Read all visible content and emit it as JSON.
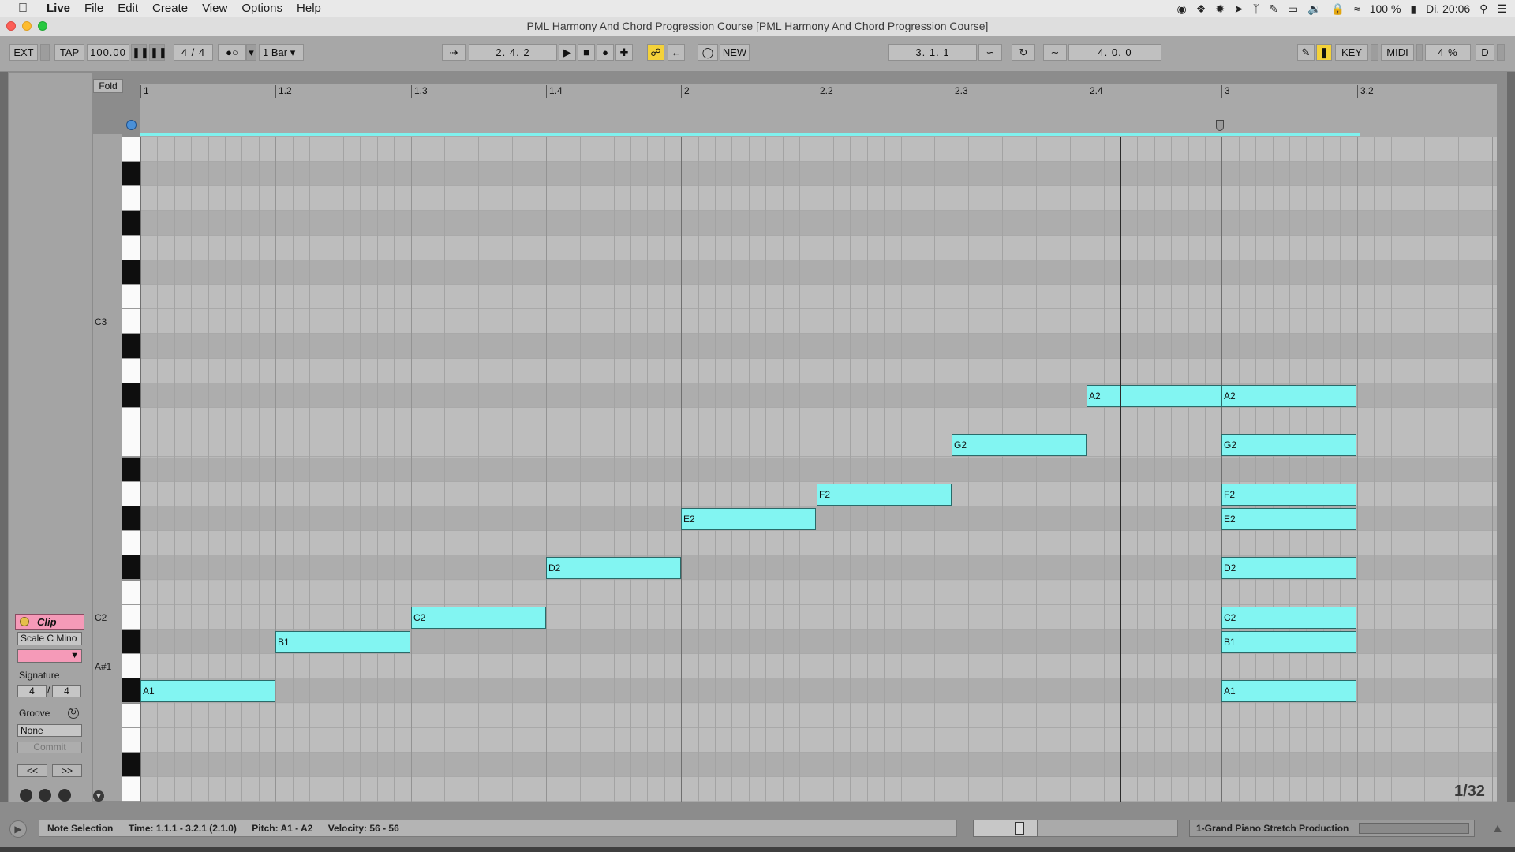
{
  "menubar": {
    "items": [
      "Live",
      "File",
      "Edit",
      "Create",
      "View",
      "Options",
      "Help"
    ],
    "battery": "100 %",
    "clock": "Di. 20:06"
  },
  "window": {
    "title": "PML Harmony And Chord Progression Course  [PML Harmony And Chord Progression Course]"
  },
  "control": {
    "ext": "EXT",
    "tap": "TAP",
    "tempo": "100.00",
    "signature": "4 / 4",
    "quantize": "1 Bar",
    "position": "2.   4.   2",
    "new": "NEW",
    "loop_start": "3.   1.   1",
    "loop_length": "4.   0.   0",
    "key": "KEY",
    "midi": "MIDI",
    "cpu": "4 %",
    "d": "D"
  },
  "editor": {
    "fold": "Fold",
    "ruler": [
      "1",
      "1.2",
      "1.3",
      "1.4",
      "2",
      "2.2",
      "2.3",
      "2.4",
      "3",
      "3.2"
    ],
    "key_labels": [
      "C3",
      "C2",
      "A#1"
    ],
    "zoom": "1/32",
    "accent": "#82f5f2",
    "notes": [
      {
        "label": "A1",
        "row": 22,
        "start": 0,
        "len": 1
      },
      {
        "label": "B1",
        "row": 20,
        "start": 1,
        "len": 1
      },
      {
        "label": "C2",
        "row": 19,
        "start": 2,
        "len": 1
      },
      {
        "label": "D2",
        "row": 17,
        "start": 3,
        "len": 1
      },
      {
        "label": "E2",
        "row": 15,
        "start": 4,
        "len": 1
      },
      {
        "label": "F2",
        "row": 14,
        "start": 5,
        "len": 1
      },
      {
        "label": "G2",
        "row": 12,
        "start": 6,
        "len": 1
      },
      {
        "label": "A2",
        "row": 10,
        "start": 7,
        "len": 1
      },
      {
        "label": "A2",
        "row": 10,
        "start": 8,
        "len": 1
      },
      {
        "label": "G2",
        "row": 12,
        "start": 8,
        "len": 1
      },
      {
        "label": "F2",
        "row": 14,
        "start": 8,
        "len": 1
      },
      {
        "label": "E2",
        "row": 15,
        "start": 8,
        "len": 1
      },
      {
        "label": "D2",
        "row": 17,
        "start": 8,
        "len": 1
      },
      {
        "label": "C2",
        "row": 19,
        "start": 8,
        "len": 1
      },
      {
        "label": "B1",
        "row": 20,
        "start": 8,
        "len": 1
      },
      {
        "label": "A1",
        "row": 22,
        "start": 8,
        "len": 1
      }
    ]
  },
  "clip": {
    "title": "Clip",
    "scale": "Scale C Mino",
    "signature_label": "Signature",
    "sig_num": "4",
    "sig_den": "4",
    "groove_label": "Groove",
    "groove_value": "None",
    "commit": "Commit",
    "prev": "<<",
    "next": ">>"
  },
  "status": {
    "mode": "Note Selection",
    "time": "Time: 1.1.1 - 3.2.1 (2.1.0)",
    "pitch": "Pitch: A1 - A2",
    "velocity": "Velocity: 56 - 56",
    "track": "1-Grand Piano Stretch Production"
  }
}
